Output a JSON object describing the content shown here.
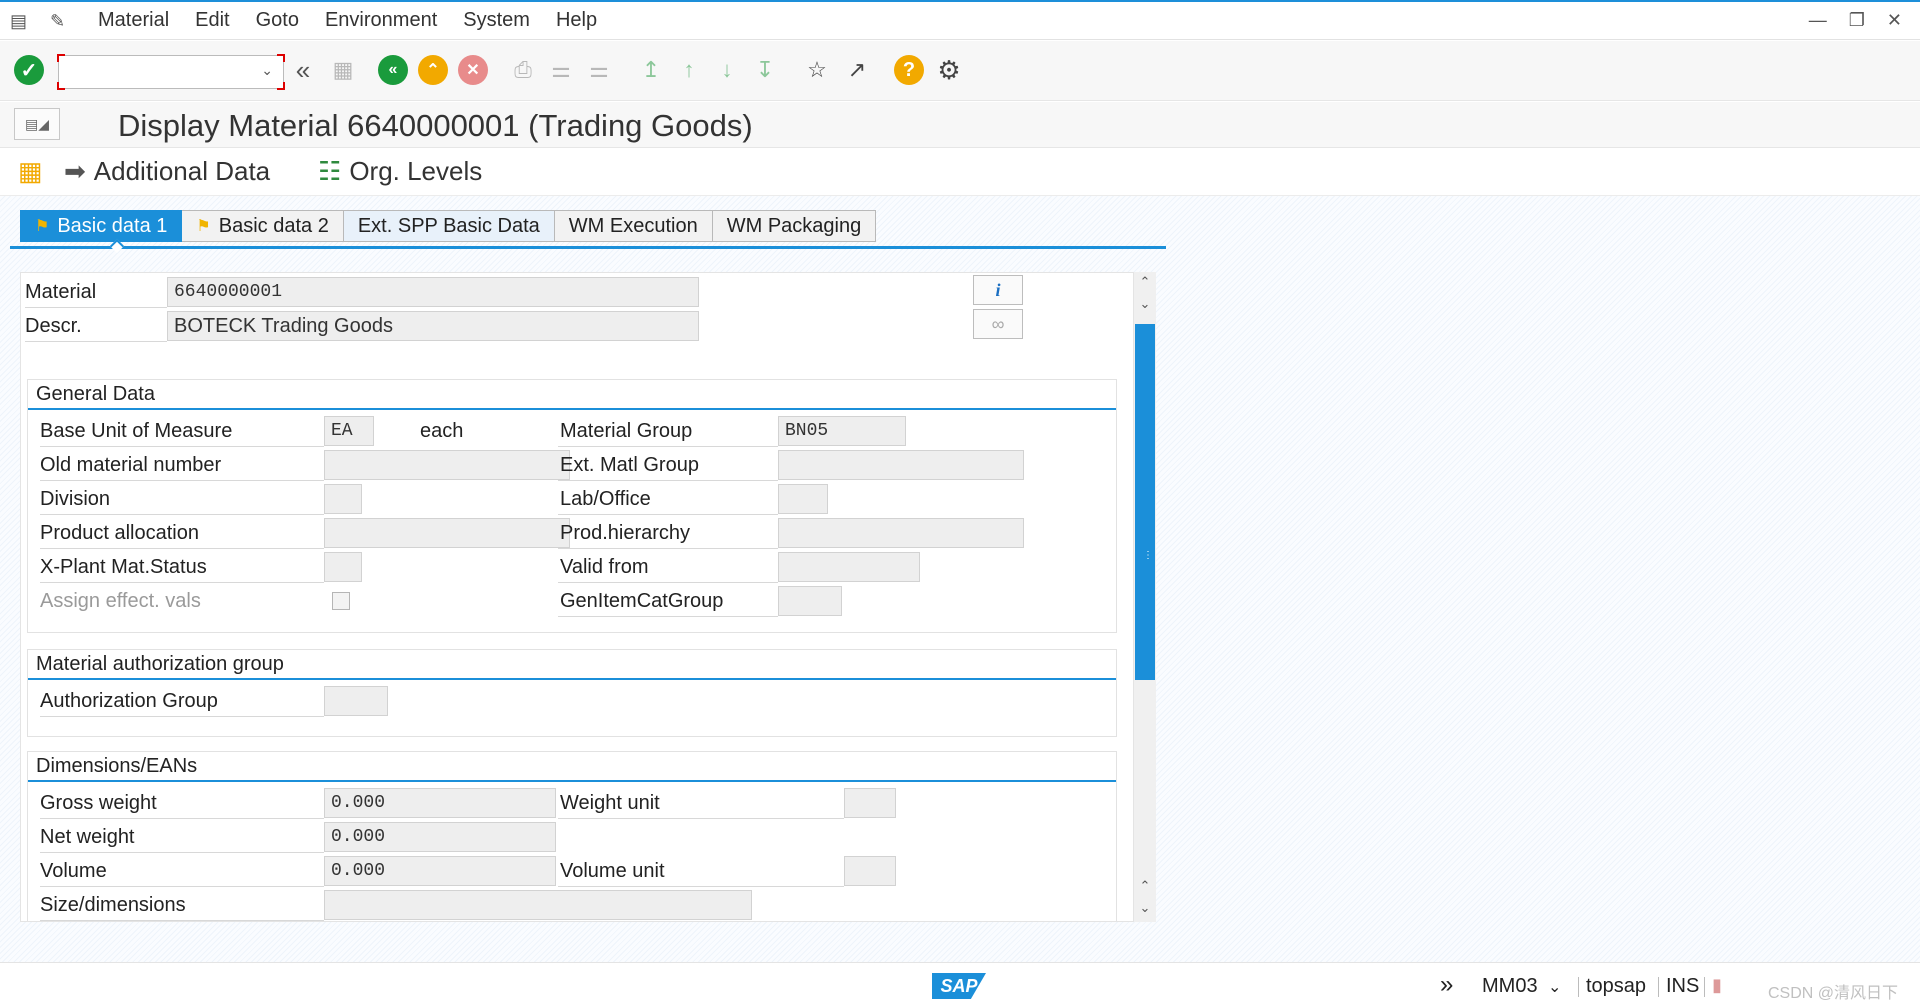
{
  "menu": {
    "items": [
      "Material",
      "Edit",
      "Goto",
      "Environment",
      "System",
      "Help"
    ]
  },
  "toolbar": {
    "command_value": "",
    "icons": [
      "enter-icon",
      "command-field",
      "back-double-icon",
      "save-icon",
      "back-icon",
      "exit-icon",
      "cancel-icon",
      "print-icon",
      "find-icon",
      "find-next-icon",
      "first-page-icon",
      "previous-page-icon",
      "next-page-icon",
      "last-page-icon",
      "create-session-icon",
      "shortcut-icon",
      "help-icon",
      "customize-layout-icon"
    ]
  },
  "title": "Display Material 6640000001 (Trading Goods)",
  "app_toolbar": {
    "additional_data": "Additional Data",
    "org_levels": "Org. Levels"
  },
  "tabs": [
    "Basic data 1",
    "Basic data 2",
    "Ext. SPP Basic Data",
    "WM Execution",
    "WM Packaging"
  ],
  "header": {
    "material_label": "Material",
    "material_value": "6640000001",
    "descr_label": "Descr.",
    "descr_value": "BOTECK Trading Goods"
  },
  "general": {
    "title": "General Data",
    "base_uom_label": "Base Unit of Measure",
    "base_uom_value": "EA",
    "base_uom_text": "each",
    "old_mat_label": "Old material number",
    "old_mat_value": "",
    "division_label": "Division",
    "division_value": "",
    "prod_alloc_label": "Product allocation",
    "prod_alloc_value": "",
    "xplant_label": "X-Plant Mat.Status",
    "xplant_value": "",
    "assign_label": "Assign effect. vals",
    "mat_group_label": "Material Group",
    "mat_group_value": "BN05",
    "ext_group_label": "Ext. Matl Group",
    "ext_group_value": "",
    "lab_label": "Lab/Office",
    "lab_value": "",
    "prodh_label": "Prod.hierarchy",
    "prodh_value": "",
    "valid_label": "Valid from",
    "valid_value": "",
    "genitem_label": "GenItemCatGroup",
    "genitem_value": ""
  },
  "auth": {
    "title": "Material authorization group",
    "group_label": "Authorization Group",
    "group_value": ""
  },
  "dims": {
    "title": "Dimensions/EANs",
    "gross_label": "Gross weight",
    "gross_value": "0.000",
    "net_label": "Net weight",
    "net_value": "0.000",
    "volume_label": "Volume",
    "volume_value": "0.000",
    "size_label": "Size/dimensions",
    "size_value": "",
    "weight_unit_label": "Weight unit",
    "weight_unit_value": "",
    "volume_unit_label": "Volume unit",
    "volume_unit_value": ""
  },
  "status": {
    "sap": "SAP",
    "transaction": "MM03",
    "server": "topsap",
    "mode": "INS",
    "watermark": "CSDN @清风日下"
  },
  "colors": {
    "accent": "#1b8fd9",
    "enter_green": "#1a9b3c",
    "back_orange": "#f2a900",
    "cancel_red": "#e04c4c"
  }
}
